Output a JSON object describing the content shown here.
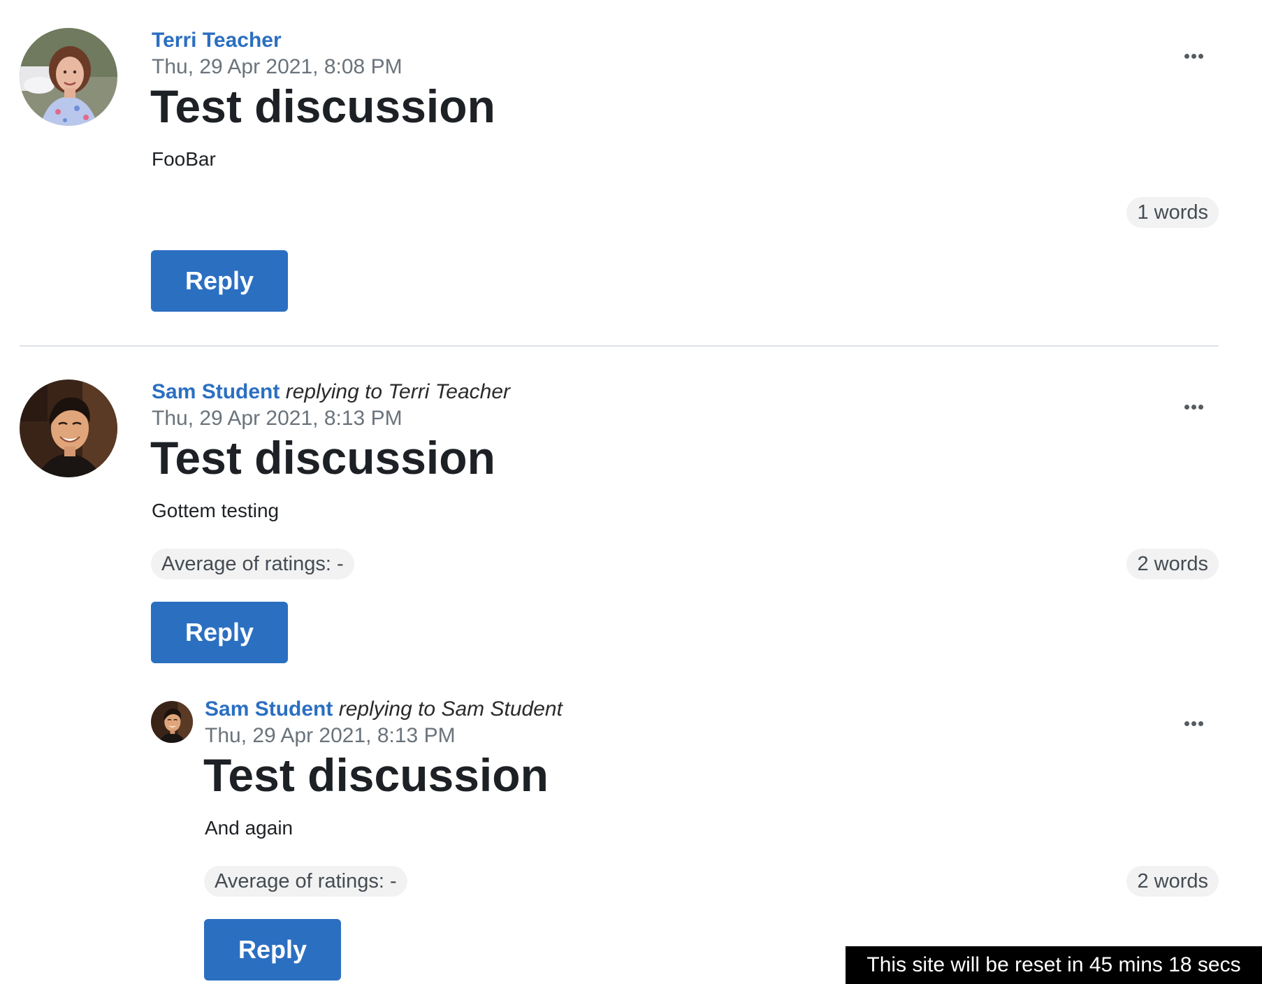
{
  "posts": [
    {
      "author": "Terri Teacher",
      "replying_prefix": "",
      "replying_to": "",
      "date": "Thu, 29 Apr 2021, 8:08 PM",
      "subject": "Test discussion",
      "body": "FooBar",
      "rating": "",
      "word_count": "1 words",
      "reply_label": "Reply"
    },
    {
      "author": "Sam Student",
      "replying_prefix": "replying to",
      "replying_to": "Terri Teacher",
      "date": "Thu, 29 Apr 2021, 8:13 PM",
      "subject": "Test discussion",
      "body": "Gottem testing",
      "rating": "Average of ratings: -",
      "word_count": "2 words",
      "reply_label": "Reply"
    },
    {
      "author": "Sam Student",
      "replying_prefix": "replying to",
      "replying_to": "Sam Student",
      "date": "Thu, 29 Apr 2021, 8:13 PM",
      "subject": "Test discussion",
      "body": "And again",
      "rating": "Average of ratings: -",
      "word_count": "2 words",
      "reply_label": "Reply"
    }
  ],
  "banner": {
    "text": "This site will be reset in 45 mins 18 secs"
  },
  "colors": {
    "link_blue": "#2b6fc1",
    "button_blue": "#2b6fc1",
    "muted_text": "#6a737b",
    "pill_bg": "#f2f2f2"
  },
  "icons": {
    "more_actions": "more-horizontal-icon"
  }
}
